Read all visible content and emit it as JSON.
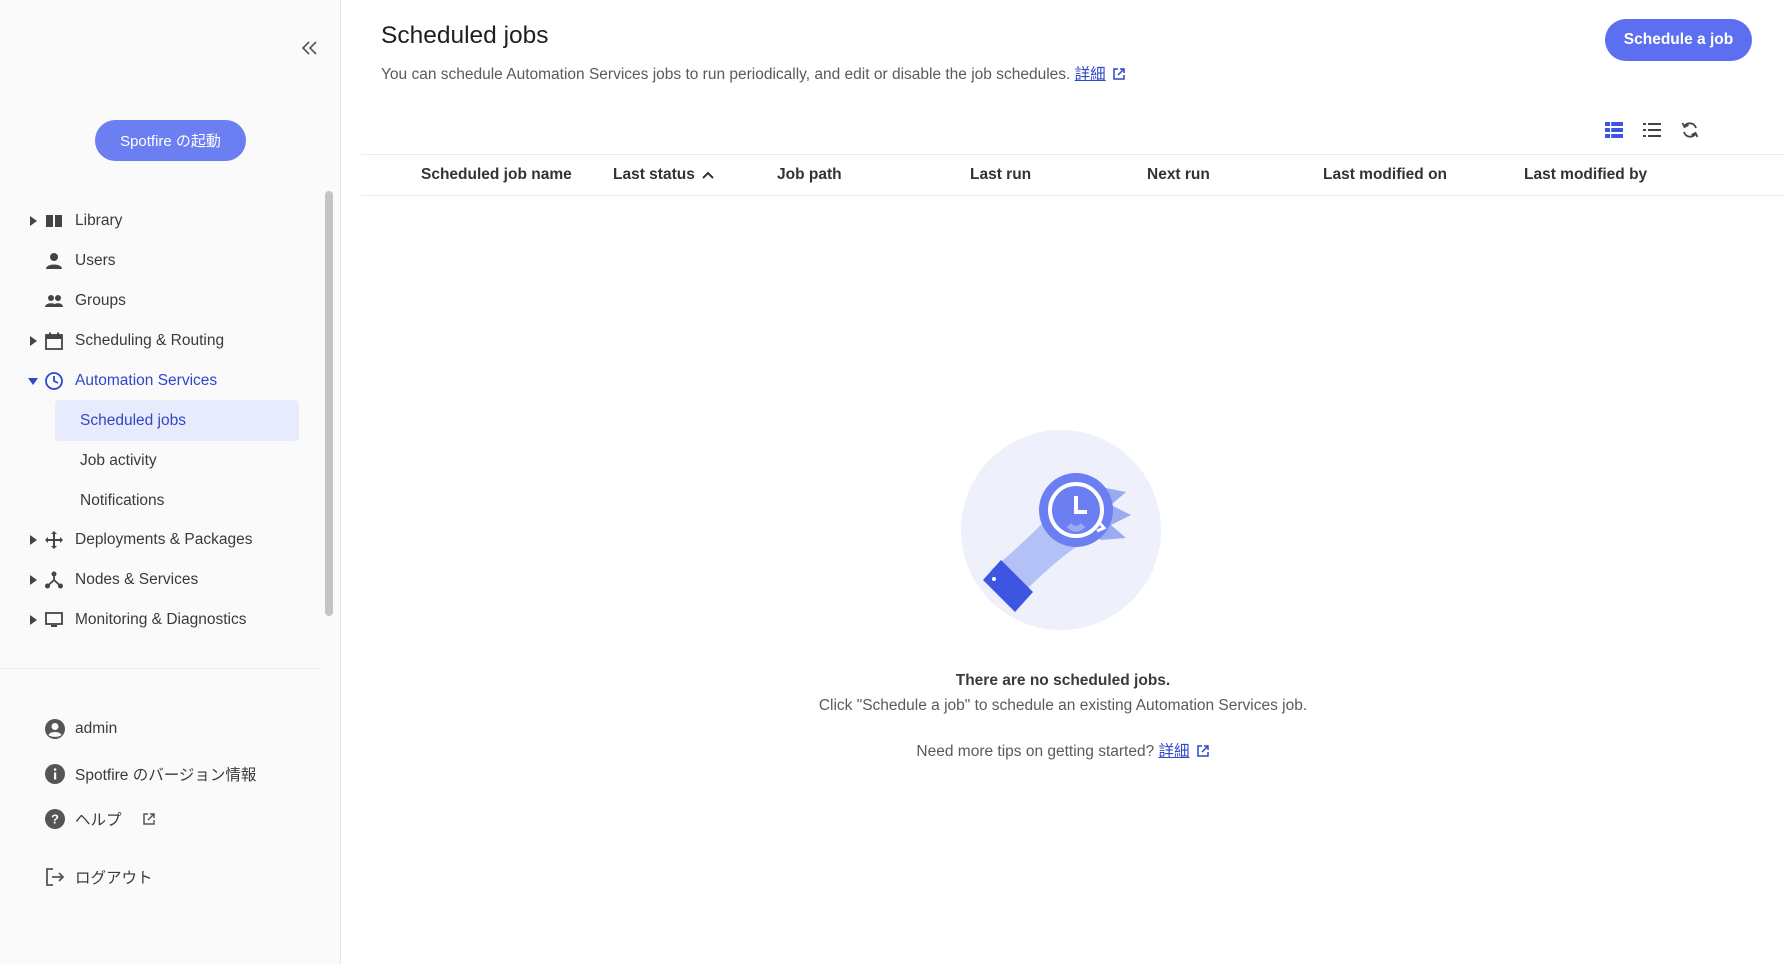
{
  "sidebar": {
    "launch_button": "Spotfire の起動",
    "nav": [
      {
        "label": "Library",
        "icon": "book-icon"
      },
      {
        "label": "Users",
        "icon": "user-icon"
      },
      {
        "label": "Groups",
        "icon": "group-icon"
      },
      {
        "label": "Scheduling & Routing",
        "icon": "calendar-icon"
      },
      {
        "label": "Automation Services",
        "icon": "clock-icon"
      },
      {
        "label": "Deployments & Packages",
        "icon": "move-icon"
      },
      {
        "label": "Nodes & Services",
        "icon": "nodes-icon"
      },
      {
        "label": "Monitoring & Diagnostics",
        "icon": "monitor-icon"
      }
    ],
    "sub_nav": [
      {
        "label": "Scheduled jobs"
      },
      {
        "label": "Job activity"
      },
      {
        "label": "Notifications"
      }
    ],
    "bottom": {
      "admin": "admin",
      "version": "Spotfire のバージョン情報",
      "help": "ヘルプ",
      "logout": "ログアウト"
    }
  },
  "header": {
    "title": "Scheduled jobs",
    "description": "You can schedule Automation Services jobs to run periodically, and edit or disable the job schedules.",
    "details_link": "詳細",
    "schedule_button": "Schedule a job"
  },
  "table": {
    "columns": [
      "Scheduled job name",
      "Last status",
      "Job path",
      "Last run",
      "Next run",
      "Last modified on",
      "Last modified by"
    ]
  },
  "empty_state": {
    "title": "There are no scheduled jobs.",
    "subtitle": "Click \"Schedule a job\" to schedule an existing Automation Services job.",
    "tip": "Need more tips on getting started?",
    "tip_link": "詳細"
  },
  "colors": {
    "accent": "#5b6ff0",
    "active_text": "#2f47c9",
    "selected_bg": "#e8ebfc"
  }
}
